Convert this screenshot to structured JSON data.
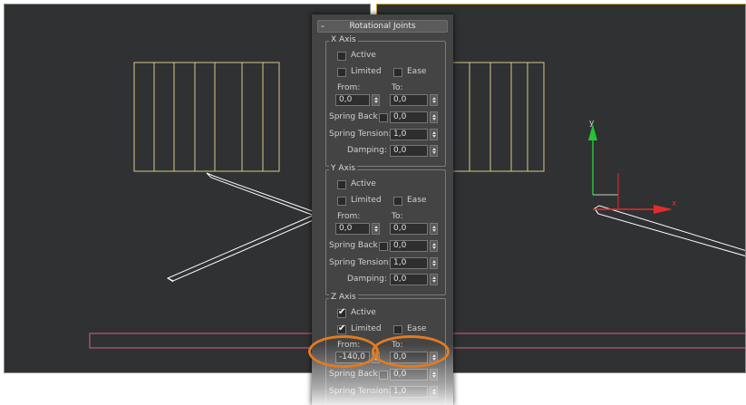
{
  "viewports": {
    "right": {
      "gizmo": {
        "y_label": "y",
        "x_label": "x",
        "y_color": "#27c23a",
        "x_color": "#e52b2b"
      }
    }
  },
  "colors": {
    "frame_wire": "#d8c98a",
    "bone_wire": "#ffffff",
    "floor_plane": "#d9608a",
    "highlight": "#e07b23",
    "active_viewport_border": "#c9a227"
  },
  "panel": {
    "title": "Rotational Joints",
    "collapse_symbol": "-",
    "x_axis": {
      "title": "X Axis",
      "active": {
        "label": "Active",
        "checked": false
      },
      "limited": {
        "label": "Limited",
        "checked": false
      },
      "ease": {
        "label": "Ease",
        "checked": false
      },
      "from_label": "From:",
      "to_label": "To:",
      "from_value": "0,0",
      "to_value": "0,0",
      "spring_back_label": "Spring Back",
      "spring_back_value": "0,0",
      "spring_tension_label": "Spring Tension:",
      "spring_tension_value": "1,0",
      "damping_label": "Damping:",
      "damping_value": "0,0"
    },
    "y_axis": {
      "title": "Y Axis",
      "active": {
        "label": "Active",
        "checked": false
      },
      "limited": {
        "label": "Limited",
        "checked": false
      },
      "ease": {
        "label": "Ease",
        "checked": false
      },
      "from_label": "From:",
      "to_label": "To:",
      "from_value": "0,0",
      "to_value": "0,0",
      "spring_back_label": "Spring Back",
      "spring_back_value": "0,0",
      "spring_tension_label": "Spring Tension:",
      "spring_tension_value": "1,0",
      "damping_label": "Damping:",
      "damping_value": "0,0"
    },
    "z_axis": {
      "title": "Z Axis",
      "active": {
        "label": "Active",
        "checked": true
      },
      "limited": {
        "label": "Limited",
        "checked": true
      },
      "ease": {
        "label": "Ease",
        "checked": false
      },
      "from_label": "From:",
      "to_label": "To:",
      "from_value": "-140,0",
      "to_value": "0,0",
      "spring_back_label": "Spring Back",
      "spring_back_value": "0,0",
      "spring_tension_label": "Spring Tension:",
      "spring_tension_value": "1,0"
    },
    "check_mark": "✔"
  }
}
